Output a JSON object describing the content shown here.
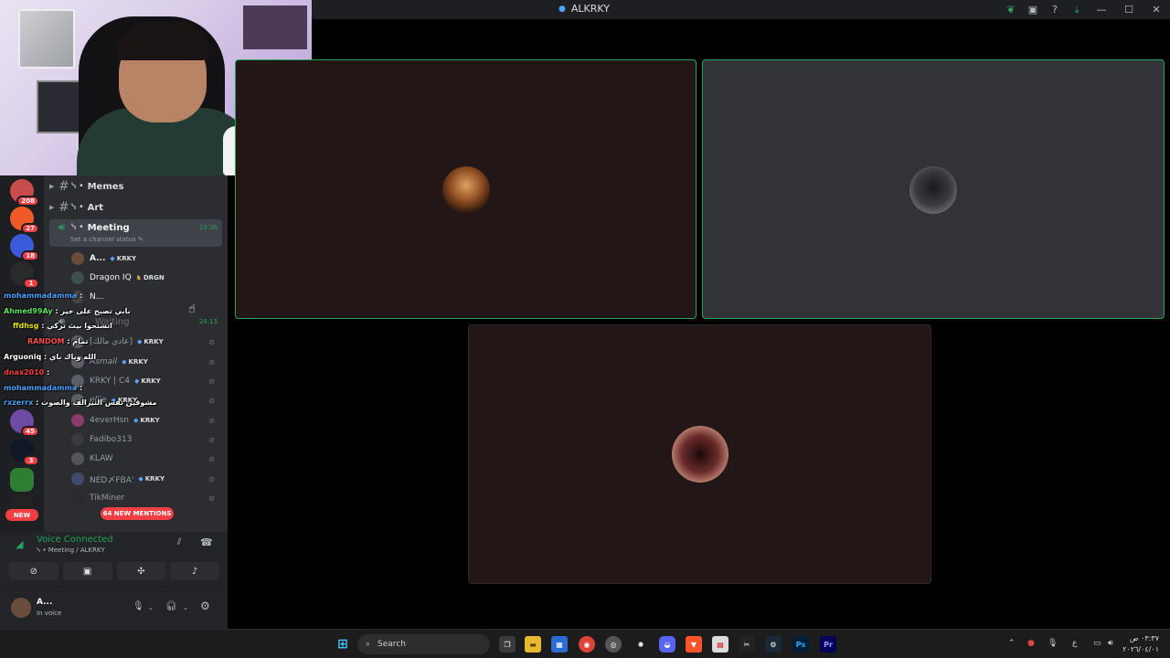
{
  "window": {
    "title": "ALKRKY"
  },
  "servers": [
    {
      "name": "server-1",
      "badge": "208",
      "color": "#c94c4c"
    },
    {
      "name": "server-2",
      "badge": "27",
      "color": "#f05a28"
    },
    {
      "name": "server-3",
      "badge": "18",
      "color": "#3b5bdb"
    },
    {
      "name": "server-4",
      "badge": "1",
      "color": "#2a2a2a"
    },
    {
      "name": "server-5",
      "badge": "45",
      "color": "#6e4ba3"
    },
    {
      "name": "server-6",
      "badge": "3",
      "color": "#101828"
    },
    {
      "name": "server-7",
      "badge": "",
      "color": "#2e7d32"
    }
  ],
  "new_label": "NEW",
  "channels": [
    {
      "name": "Memes",
      "prefix": "ᓭ •"
    },
    {
      "name": "Art",
      "prefix": "ᓭ •"
    }
  ],
  "voice_channel": {
    "name": "Meeting",
    "prefix": "ᓭ •",
    "time": "23:36",
    "status_placeholder": "Set a channel status"
  },
  "members_top": [
    {
      "name": "A...",
      "tag": "KRKY"
    },
    {
      "name": "Dragon IQ",
      "tag": "DRGN"
    },
    {
      "name": "N...",
      "tag": ""
    }
  ],
  "waiting_channel": {
    "name": "Waiting",
    "time": "24:13"
  },
  "members": [
    {
      "name": "[عادي مالك]",
      "tag": "KRKY"
    },
    {
      "name": "Asmail",
      "tag": "KRKY"
    },
    {
      "name": "KRKY | C4",
      "tag": "KRKY"
    },
    {
      "name": "ellie",
      "tag": "KRKY"
    },
    {
      "name": "4everHsn",
      "tag": "KRKY"
    },
    {
      "name": "Fadibo313",
      "tag": ""
    },
    {
      "name": "KLAW",
      "tag": ""
    },
    {
      "name": "NED〆FBA'",
      "tag": "KRKY"
    },
    {
      "name": "TikMiner",
      "tag": ""
    }
  ],
  "mentions_label": "64 NEW MENTIONS",
  "voice_panel": {
    "status": "Voice Connected",
    "location": "ᓭ • Meeting / ALKRKY"
  },
  "user_panel": {
    "name": "A...",
    "status": "In voice"
  },
  "chat": [
    {
      "user": "mohammadamma",
      "msg": ":",
      "color": "#4aa3ff"
    },
    {
      "user": "Ahmed99Ay",
      "msg": ": بابي تصبح على خير",
      "color": "#5ee35e"
    },
    {
      "user": "ffdhsg",
      "msg": ": اتشتحوا بيث تركي",
      "color": "#e6e600"
    },
    {
      "user": "RANDOM",
      "msg": ": تمام",
      "color": "#ff4d4d"
    },
    {
      "user": "Arguoniq",
      "msg": ": الله وياك باي",
      "color": "#ffffff"
    },
    {
      "user": "dnax2010",
      "msg": ":",
      "color": "#ff3b3b"
    },
    {
      "user": "mohammadamma",
      "msg": ":",
      "color": "#4aa3ff"
    },
    {
      "user": "rxzerrx",
      "msg": ": مشوقين نفس التيرالف والصوت",
      "color": "#4aa3ff"
    }
  ],
  "taskbar": {
    "search_label": "Search",
    "lang": "ع",
    "time": "٠٣:٣٧ ص",
    "date": "٢٠٢٦/٠٤/٠١"
  },
  "colors": {
    "accent_green": "#23a55a",
    "mention_red": "#f23f43",
    "bg_dark": "#1e1f22"
  }
}
